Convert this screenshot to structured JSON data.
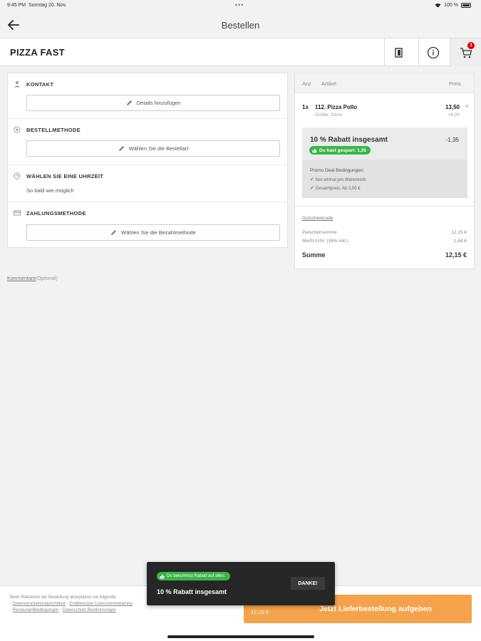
{
  "status_bar": {
    "time": "9:45 PM",
    "date": "Sonntag 20. Nov.",
    "dots": "•••",
    "battery": "100 %"
  },
  "nav": {
    "title": "Bestellen"
  },
  "restaurant": {
    "name": "PIZZA FAST",
    "cart_count": "1"
  },
  "checkout": {
    "contact": {
      "title": "KONTAKT",
      "button": "Details hinzufügen"
    },
    "method": {
      "title": "BESTELLMETHODE",
      "button": "Wählen Sie die Bestellart"
    },
    "time": {
      "title": "WÄHLEN SIE EINE UHRZEIT",
      "value": "So bald wie möglich"
    },
    "payment": {
      "title": "ZAHLUNGSMETHODE",
      "button": "Wählen Sie die Bezahlmethode"
    }
  },
  "comment": {
    "link": "Kommentare",
    "optional": "(Optional)"
  },
  "cart": {
    "head": {
      "qty": "Anz",
      "item": "Artikel",
      "price": "Preis"
    },
    "items": [
      {
        "qty": "1x",
        "name": "112. Pizza Pollo",
        "price": "13,50",
        "size": "Größe: 33cm",
        "extra": "+4,00"
      }
    ],
    "promo": {
      "title": "10 % Rabatt insgesamt",
      "discount": "-1,35",
      "badge": "Du hast gespart: 1,35",
      "conditions_title": "Promo Deal Bedingungen:",
      "conditions": [
        "Nur einmal pro Warenkorb",
        "Gesamtpreis: Ab 3,00 €"
      ]
    },
    "voucher": "Gutscheincode",
    "subtotal_label": "Zwischensumme",
    "subtotal": "12,15 €",
    "vat_label": "MwSt./USt. (16% inkl.)",
    "vat": "1,68 €",
    "total_label": "Summe",
    "total": "12,15 €"
  },
  "bottom": {
    "legal_prefix": "Beim Platzieren der Bestellung akzeptieren sie folgende",
    "legal_links": [
      "Datenverarbeitungsrichtlinie",
      "Endbenutzer-Lizenzvereinbarung",
      "RestaurantBedingungen",
      "Datenschutz Bestimmungen"
    ],
    "order_amount": "12,15 €",
    "order_label": "Jetzt Lieferbestellung aufgeben"
  },
  "toast": {
    "badge": "Du bekommst Rabatt auf alles:",
    "title": "10 % Rabatt insgesamt",
    "button": "DANKE!"
  },
  "colors": {
    "accent": "#f4a34a",
    "green": "#3bb54a",
    "badge_red": "#dd0000"
  }
}
